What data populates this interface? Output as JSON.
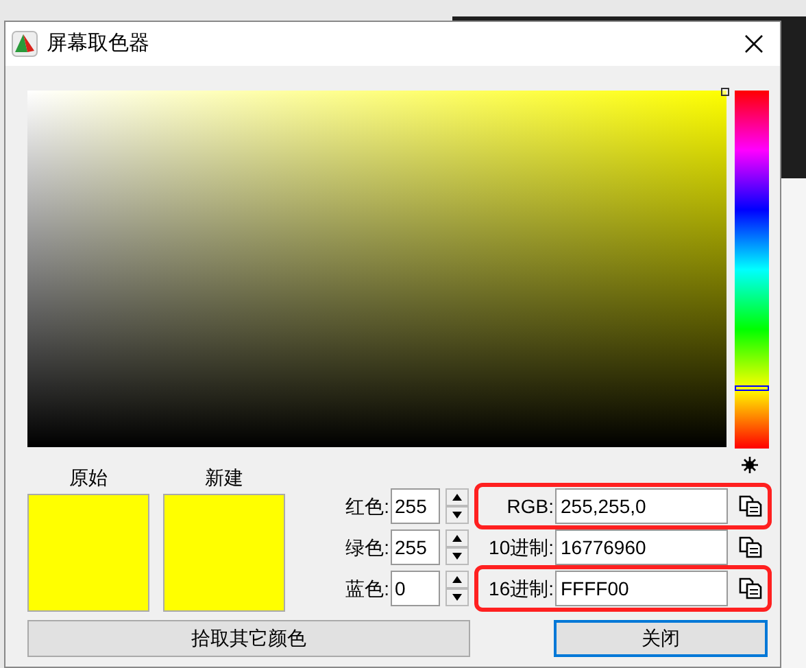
{
  "window": {
    "title": "屏幕取色器"
  },
  "hue_slider": {
    "level": 0.167
  },
  "swatches": [
    {
      "label": "原始",
      "color": "#ffff00"
    },
    {
      "label": "新建",
      "color": "#ffff00"
    }
  ],
  "channels": [
    {
      "label": "红色:",
      "value": "255"
    },
    {
      "label": "绿色:",
      "value": "255"
    },
    {
      "label": "蓝色:",
      "value": "0"
    }
  ],
  "formats": [
    {
      "label": "RGB:",
      "value": "255,255,0",
      "highlighted": true
    },
    {
      "label": "10进制:",
      "value": "16776960",
      "highlighted": false
    },
    {
      "label": "16进制:",
      "value": "FFFF00",
      "highlighted": true
    }
  ],
  "buttons": [
    {
      "label": "拾取其它颜色",
      "default": false
    },
    {
      "label": "关闭",
      "default": true
    }
  ]
}
